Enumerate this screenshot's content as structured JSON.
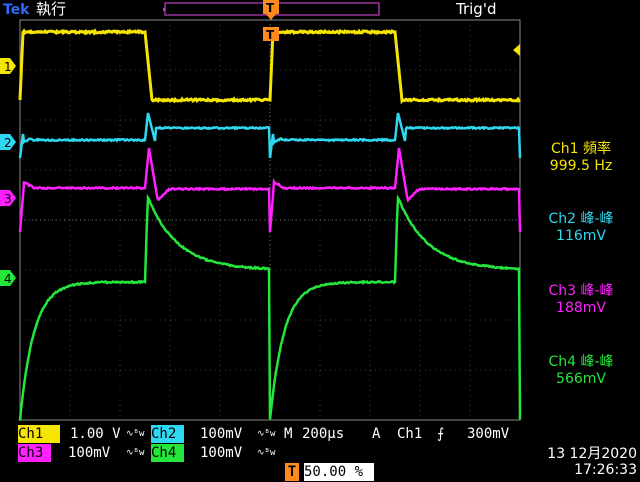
{
  "header": {
    "brand": "Tek",
    "run_state": "執行",
    "trigger_status": "Trig'd"
  },
  "channels": {
    "ch1": {
      "marker": "1",
      "color": "#f5e500",
      "scale": "1.00 V",
      "label": "Ch1"
    },
    "ch2": {
      "marker": "2",
      "color": "#2fd8f0",
      "scale": "100mV",
      "label": "Ch2"
    },
    "ch3": {
      "marker": "3",
      "color": "#ff20ff",
      "scale": "100mV",
      "label": "Ch3"
    },
    "ch4": {
      "marker": "4",
      "color": "#25e63b",
      "scale": "100mV",
      "label": "Ch4"
    }
  },
  "measurements": [
    {
      "name": "Ch1 頻率",
      "value": "999.5 Hz"
    },
    {
      "name": "Ch2 峰-峰",
      "value": "116mV"
    },
    {
      "name": "Ch3 峰-峰",
      "value": "188mV"
    },
    {
      "name": "Ch4 峰-峰",
      "value": "566mV"
    }
  ],
  "timebase": {
    "mode": "M",
    "scale": "200µs",
    "acq": "A",
    "trigger_source": "Ch1",
    "trigger_level": "300mV"
  },
  "trigger_position": "50.00 %",
  "trigger_marker": "T",
  "datetime": {
    "date": "13 12月2020",
    "time": "17:26:33"
  }
}
